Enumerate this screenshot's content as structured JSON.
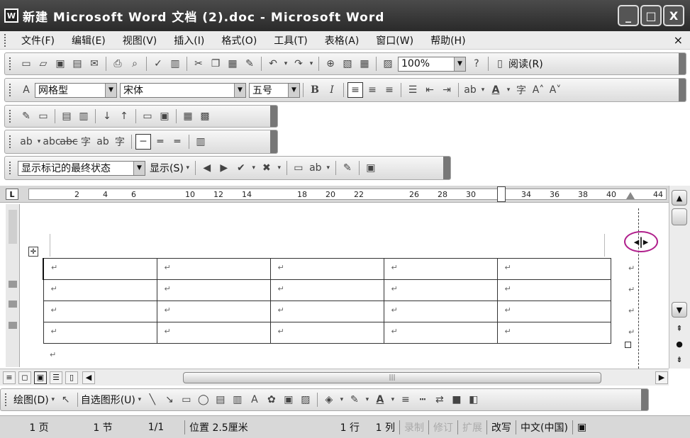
{
  "window": {
    "app_icon": "W",
    "title": "新建 Microsoft Word 文档 (2).doc - Microsoft Word",
    "controls": [
      "_",
      "□",
      "X"
    ]
  },
  "menu": {
    "items": [
      "文件(F)",
      "编辑(E)",
      "视图(V)",
      "插入(I)",
      "格式(O)",
      "工具(T)",
      "表格(A)",
      "窗口(W)",
      "帮助(H)"
    ],
    "close": "×"
  },
  "standard_toolbar": {
    "zoom": "100%",
    "read_label": "阅读(R)"
  },
  "format_toolbar": {
    "style": "网格型",
    "font": "宋体",
    "size": "五号"
  },
  "review_toolbar": {
    "display_mode": "显示标记的最终状态",
    "show_label": "显示(S)"
  },
  "ruler": {
    "tab_marker": "L",
    "numbers": [
      "2",
      "4",
      "6",
      "10",
      "12",
      "14",
      "18",
      "20",
      "22",
      "26",
      "28",
      "30",
      "34",
      "36",
      "38",
      "40",
      "44"
    ]
  },
  "table": {
    "rows": 4,
    "cols": 5,
    "cell_mark": "↵"
  },
  "drawing_toolbar": {
    "draw_label": "绘图(D)",
    "autoshape_label": "自选图形(U)"
  },
  "status": {
    "page": "1 页",
    "section": "1 节",
    "page_of": "1/1",
    "position": "位置 2.5厘米",
    "line": "1 行",
    "column": "1 列",
    "rec": "录制",
    "trk": "修订",
    "ext": "扩展",
    "ovr": "改写",
    "language": "中文(中国)"
  }
}
